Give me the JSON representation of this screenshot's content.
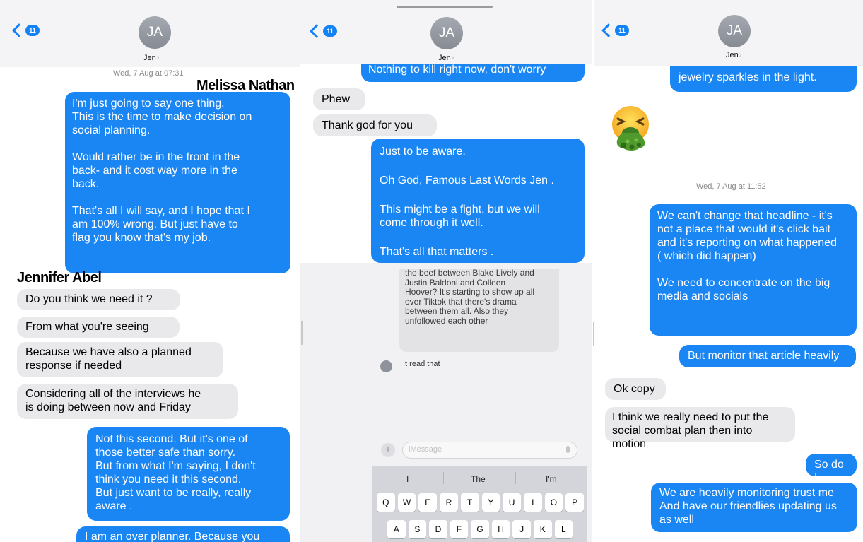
{
  "contact": {
    "initials": "JA",
    "name": "Jen",
    "back_badge": "11"
  },
  "labels": {
    "left_sender": "Melissa Nathan",
    "right_sender": "Jennifer Abel"
  },
  "panel1": {
    "timestamp": "Wed, 7 Aug at 07:31",
    "msg1": "I'm just going to say one thing.\nThis is the time to make decision on\nsocial planning.\n\nWould rather be in the front in the\nback- and it cost way more in the\nback.\n\nThat's all I will say, and I hope that I\nam 100% wrong. But just have to\nflag you know that's my job.",
    "in1": "Do you think we need it ?",
    "in2": "From what you're seeing",
    "in3": "Because we have also a planned\nresponse if needed",
    "in4": "Considering all of the interviews he\nis doing between now and Friday",
    "out2": "Not this second. But it's one of\nthose better safe than sorry.\nBut from what I'm saying, I don't\nthink you need it this second.\nBut just want to be really, really\naware .",
    "out3": "I am an over planner. Because you"
  },
  "panel2": {
    "top_partial": "Nothing to kill right now, don't worry",
    "in1": "Phew",
    "in2": "Thank god for you",
    "out1": "Just to be aware.",
    "out2": "Oh God, Famous Last Words Jen .",
    "out3": "This might be a fight, but we will\ncome through it well.",
    "out4": "That's all that matters .",
    "quoted": "the beef between Blake Lively and\nJustin Baldoni and Colleen\nHoover? It's starting to show up all\nover Tiktok that there's drama\nbetween them all. Also they\nunfollowed each other",
    "reply": "It read that",
    "compose_placeholder": "iMessage",
    "suggestions": [
      "I",
      "The",
      "I'm"
    ],
    "keys_row1": [
      "Q",
      "W",
      "E",
      "R",
      "T",
      "Y",
      "U",
      "I",
      "O",
      "P"
    ],
    "keys_row2": [
      "A",
      "S",
      "D",
      "F",
      "G",
      "H",
      "J",
      "K",
      "L"
    ]
  },
  "panel3": {
    "top_partial": "jewelry sparkles in the light.",
    "emoji": "face-vomiting",
    "timestamp": "Wed, 7 Aug at 11:52",
    "out1": "We can't change that headline - it's\nnot a place that would it's click bait\nand it's reporting on what happened\n( which did happen)\n\nWe need to concentrate on the big\nmedia and socials",
    "out2": "But monitor that article heavily",
    "in1": "Ok copy",
    "in2": "I think we really need to put the\nsocial combat plan then into motion",
    "out3": "So do I",
    "out4": "We are heavily monitoring trust me\nAnd have our friendlies updating us\nas well"
  }
}
